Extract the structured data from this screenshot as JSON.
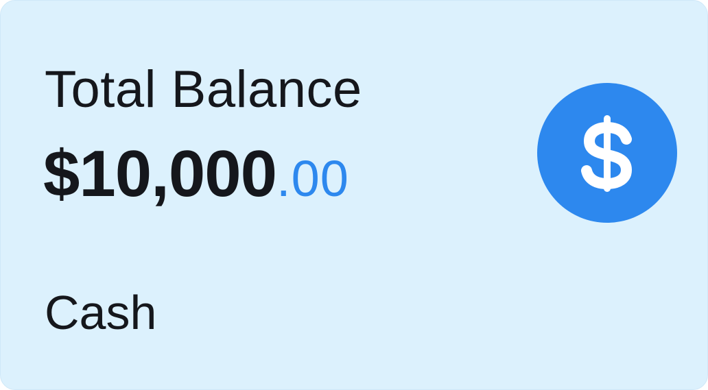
{
  "card": {
    "title": "Total Balance",
    "balance_whole": "$10,000",
    "balance_cents": ".00",
    "account_type": "Cash",
    "icon": "dollar-sign-icon"
  },
  "colors": {
    "background": "#dcf1fd",
    "text": "#15171c",
    "accent": "#2d88ee",
    "icon_glyph": "#ffffff"
  }
}
